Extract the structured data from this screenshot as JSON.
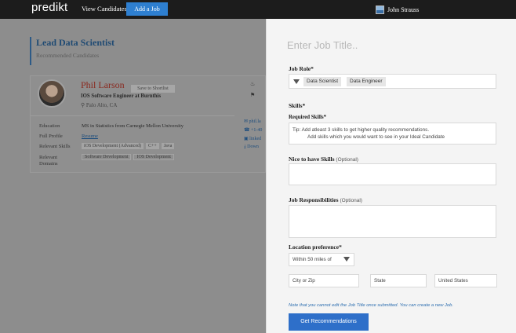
{
  "nav": {
    "logo": "predikt",
    "view_candidates": "View Candidates",
    "add_job": "Add a Job",
    "user_name": "John Strauss"
  },
  "left": {
    "job_title": "Lead Data Scientist",
    "job_subtitle": "Recommended Candidates",
    "candidate": {
      "name": "Phil Larson",
      "shortlist": "Save to Shortlist",
      "role": "IOS Software Engineer at Burnthis",
      "location": "Palo Alto, CA",
      "education_label": "Education",
      "education_value": "MS in Statistics from Carnegie Mellon University",
      "full_profile_label": "Full Profile",
      "full_profile_value": "Resume",
      "relevant_skills_label": "Relevant Skills",
      "relevant_skills": [
        "iOS Development (Advanced)",
        "C++",
        "Java"
      ],
      "relevant_domains_label": "Relevant\nDomains",
      "relevant_domains": [
        "Software Development",
        "IOS Development"
      ],
      "contact": [
        "phil.la",
        "+1-40",
        "linked",
        "Down"
      ]
    }
  },
  "panel": {
    "title_placeholder": "Enter Job Title..",
    "job_role_label": "Job Role*",
    "job_roles": [
      "Data Scientist",
      "Data Engineer"
    ],
    "skills_label": "Skills*",
    "required_skills_label": "Required Skills*",
    "tip_line1": "Tip:  Add atleast 3 skills to get higher quality recommendations.",
    "tip_line2": "Add skills which you would want to see in your Ideal Candidate",
    "nice_label": "Nice to have Skills",
    "nice_optional": "(Optional)",
    "resp_label": "Job Responsibilities",
    "resp_optional": "(Optional)",
    "location_label": "Location preference*",
    "distance": "Within 50 miles of",
    "city_placeholder": "City or Zip",
    "state_placeholder": "State",
    "country": "United States",
    "note": "Note that you cannot edit the Job Title once submitted. You can create a new Job.",
    "submit": "Get Recommendations"
  }
}
